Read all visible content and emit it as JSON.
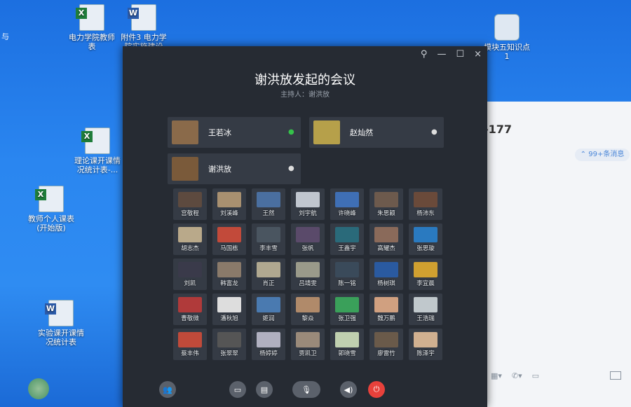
{
  "desktop": {
    "left_edge_text": "与",
    "icons": [
      {
        "label": "电力学院教师\n表",
        "kind": "xls"
      },
      {
        "label": "附件3 电力学\n院实施建设",
        "kind": "doc"
      },
      {
        "label": "模块五知识点\n1",
        "kind": "tool"
      },
      {
        "label": "理论课开课情\n况统计表-...",
        "kind": "xls"
      },
      {
        "label": "教师个人课表\n(开始版)",
        "kind": "xls"
      },
      {
        "label": "实验课开课情\n况统计表",
        "kind": "doc"
      }
    ]
  },
  "background_chat": {
    "number_text": "-177",
    "more_messages": "⌃ 99+条消息"
  },
  "meeting": {
    "title": "谢洪放发起的会议",
    "host": "主持人：谢洪放",
    "speakers": [
      {
        "name": "王若冰",
        "mic": "active",
        "color": "#8a6a4a"
      },
      {
        "name": "赵灿然",
        "mic": "idle",
        "color": "#b6a04a"
      },
      {
        "name": "谢洪放",
        "mic": "idle",
        "color": "#7a5a3a"
      }
    ],
    "participants": [
      {
        "name": "宫敬程",
        "color": "#5d4a3f"
      },
      {
        "name": "刘溪峰",
        "color": "#a89070"
      },
      {
        "name": "王然",
        "color": "#4a6fa0"
      },
      {
        "name": "刘宇航",
        "color": "#c0c6cf"
      },
      {
        "name": "许晓峰",
        "color": "#3f6fb5"
      },
      {
        "name": "朱思颖",
        "color": "#6d5a4d"
      },
      {
        "name": "杨沛东",
        "color": "#6a4a3a"
      },
      {
        "name": "胡志杰",
        "color": "#b9a98a"
      },
      {
        "name": "马国栋",
        "color": "#c24a3a"
      },
      {
        "name": "李丰雪",
        "color": "#4a5560"
      },
      {
        "name": "张帆",
        "color": "#5a4a6a"
      },
      {
        "name": "王鑫宇",
        "color": "#2a6a7a"
      },
      {
        "name": "高耀杰",
        "color": "#8a6a5a"
      },
      {
        "name": "张思璇",
        "color": "#2a7ac0"
      },
      {
        "name": "刘凯",
        "color": "#3a3a4a"
      },
      {
        "name": "韩富龙",
        "color": "#8a7a6a"
      },
      {
        "name": "肖正",
        "color": "#b0a890"
      },
      {
        "name": "吕靖雯",
        "color": "#9a9a8a"
      },
      {
        "name": "陈一铭",
        "color": "#3a4a5a"
      },
      {
        "name": "杨树琪",
        "color": "#2a5aa0"
      },
      {
        "name": "李宜晨",
        "color": "#d0a030"
      },
      {
        "name": "曹敬微",
        "color": "#b03a3a"
      },
      {
        "name": "潘秋旭",
        "color": "#ddd"
      },
      {
        "name": "姬润",
        "color": "#4a7ab0"
      },
      {
        "name": "黎焱",
        "color": "#b08a6a"
      },
      {
        "name": "张卫强",
        "color": "#3aa05a"
      },
      {
        "name": "魏万鹏",
        "color": "#d0a080"
      },
      {
        "name": "王浩瑞",
        "color": "#c0c8cc"
      },
      {
        "name": "蔡丰伟",
        "color": "#c04a3a"
      },
      {
        "name": "张翠翠",
        "color": "#555"
      },
      {
        "name": "杨婷婷",
        "color": "#b0b0c0"
      },
      {
        "name": "贾凯卫",
        "color": "#9a8a7a"
      },
      {
        "name": "郭晓雪",
        "color": "#c0d0b0"
      },
      {
        "name": "廖雷竹",
        "color": "#6a5a4a"
      },
      {
        "name": "陈泽宇",
        "color": "#d0b090"
      }
    ],
    "controls": {
      "minimize": "—",
      "maximize": "☐",
      "close": "×",
      "pin": "⚲"
    }
  }
}
